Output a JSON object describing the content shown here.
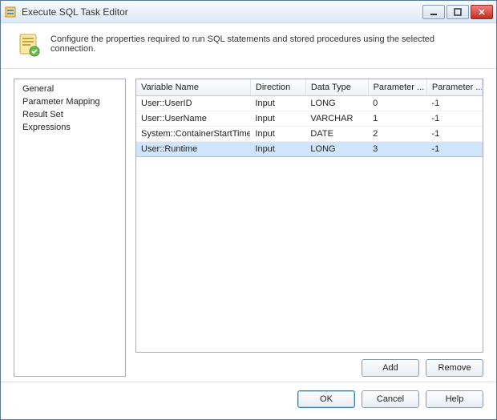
{
  "title": "Execute SQL Task Editor",
  "description": "Configure the properties required to run SQL statements and stored procedures using the selected connection.",
  "sidebar": {
    "items": [
      {
        "label": "General"
      },
      {
        "label": "Parameter Mapping"
      },
      {
        "label": "Result Set"
      },
      {
        "label": "Expressions"
      }
    ]
  },
  "grid": {
    "columns": [
      "Variable Name",
      "Direction",
      "Data Type",
      "Parameter ...",
      "Parameter ..."
    ],
    "rows": [
      {
        "variable": "User::UserID",
        "direction": "Input",
        "datatype": "LONG",
        "paramname": "0",
        "paramsize": "-1",
        "selected": false
      },
      {
        "variable": "User::UserName",
        "direction": "Input",
        "datatype": "VARCHAR",
        "paramname": "1",
        "paramsize": "-1",
        "selected": false
      },
      {
        "variable": "System::ContainerStartTime",
        "direction": "Input",
        "datatype": "DATE",
        "paramname": "2",
        "paramsize": "-1",
        "selected": false
      },
      {
        "variable": "User::Runtime",
        "direction": "Input",
        "datatype": "LONG",
        "paramname": "3",
        "paramsize": "-1",
        "selected": true
      }
    ]
  },
  "buttons": {
    "add": "Add",
    "remove": "Remove",
    "ok": "OK",
    "cancel": "Cancel",
    "help": "Help"
  }
}
